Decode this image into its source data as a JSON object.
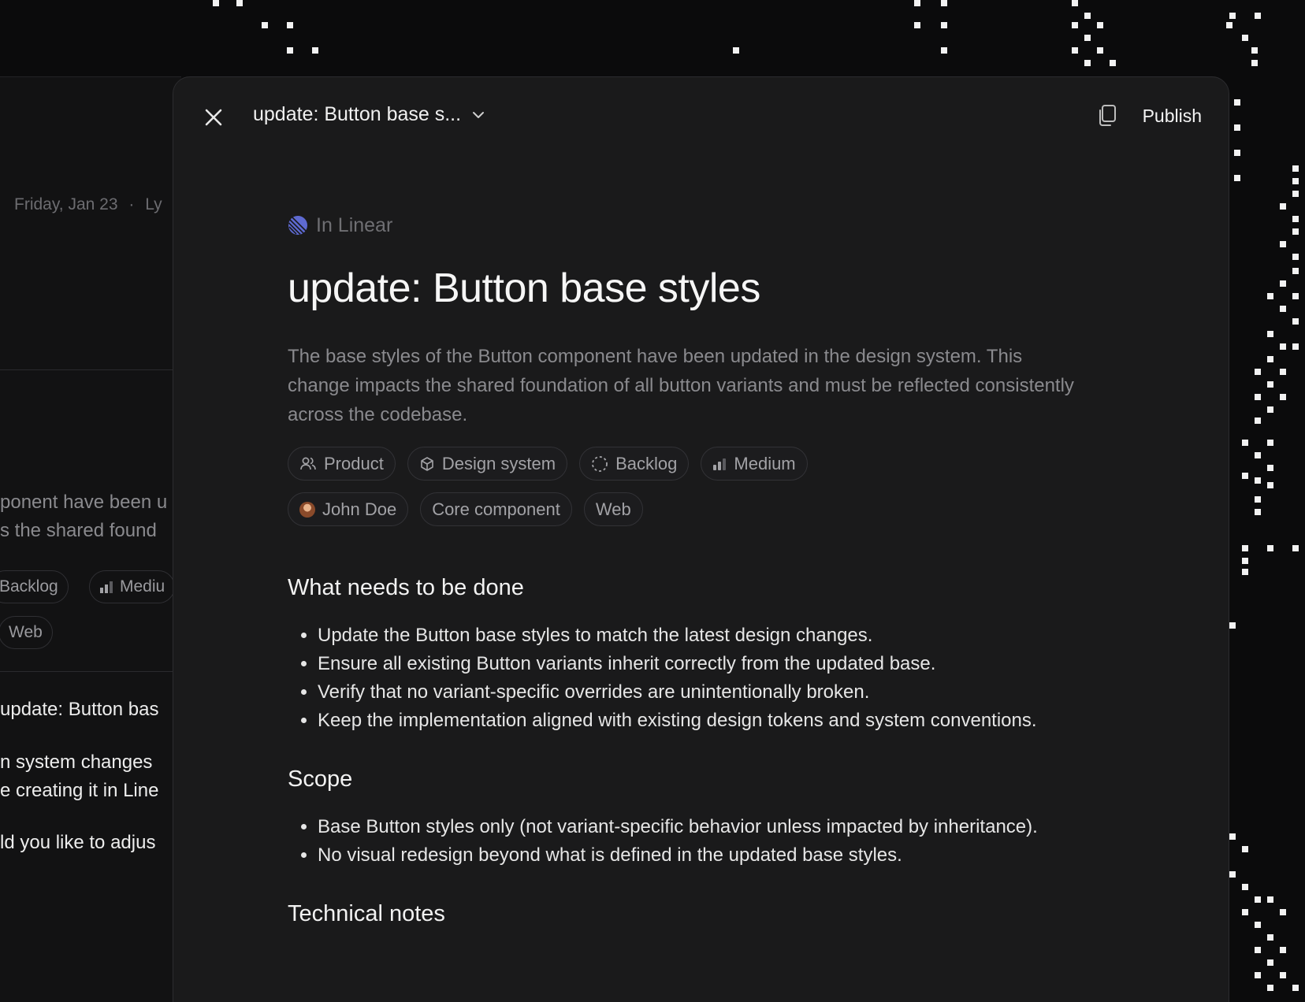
{
  "background": {
    "date": "Friday, Jan 23",
    "meta_separator": "·",
    "meta_more": "Ly",
    "desc_line1": "ponent have been u",
    "desc_line2": "s the shared found",
    "chips": [
      {
        "label": "Backlog",
        "icon": "dashed-circle-icon"
      },
      {
        "label": "Mediu",
        "icon": "priority-bars-icon"
      }
    ],
    "chip_web": "Web",
    "msg_title": "update: Button bas",
    "msg_line1": "n system changes",
    "msg_line2": "e creating it in Line",
    "msg_line3": "ld you like to adjus"
  },
  "modal": {
    "title": "update: Button base s...",
    "publish_label": "Publish",
    "source_label": "In Linear",
    "doc_title": "update: Button base styles",
    "description": "The base styles of the Button component have been updated in the design system. This change impacts the shared foundation of all button variants and must be reflected consistently across the codebase.",
    "chips": [
      {
        "label": "Product",
        "icon": "team-icon"
      },
      {
        "label": "Design system",
        "icon": "cube-icon"
      },
      {
        "label": "Backlog",
        "icon": "dashed-circle-icon"
      },
      {
        "label": "Medium",
        "icon": "priority-bars-icon"
      },
      {
        "label": "John Doe",
        "icon": "avatar"
      },
      {
        "label": "Core component",
        "icon": ""
      },
      {
        "label": "Web",
        "icon": ""
      }
    ],
    "sections": [
      {
        "heading": "What needs to be done",
        "items": [
          "Update the Button base styles to match the latest design changes.",
          "Ensure all existing Button variants inherit correctly from the updated base.",
          "Verify that no variant-specific overrides are unintentionally broken.",
          "Keep the implementation aligned with existing design tokens and system conventions."
        ]
      },
      {
        "heading": "Scope",
        "items": [
          "Base Button styles only (not variant-specific behavior unless impacted by inheritance).",
          "No visual redesign beyond what is defined in the updated base styles."
        ]
      },
      {
        "heading": "Technical notes",
        "items": []
      }
    ]
  },
  "colors": {
    "background": "#0b0b0c",
    "modal": "#1a1a1b",
    "linear_brand": "#5e6ad2",
    "text_primary": "#f6f6f6",
    "text_muted": "#8a8a8e"
  }
}
